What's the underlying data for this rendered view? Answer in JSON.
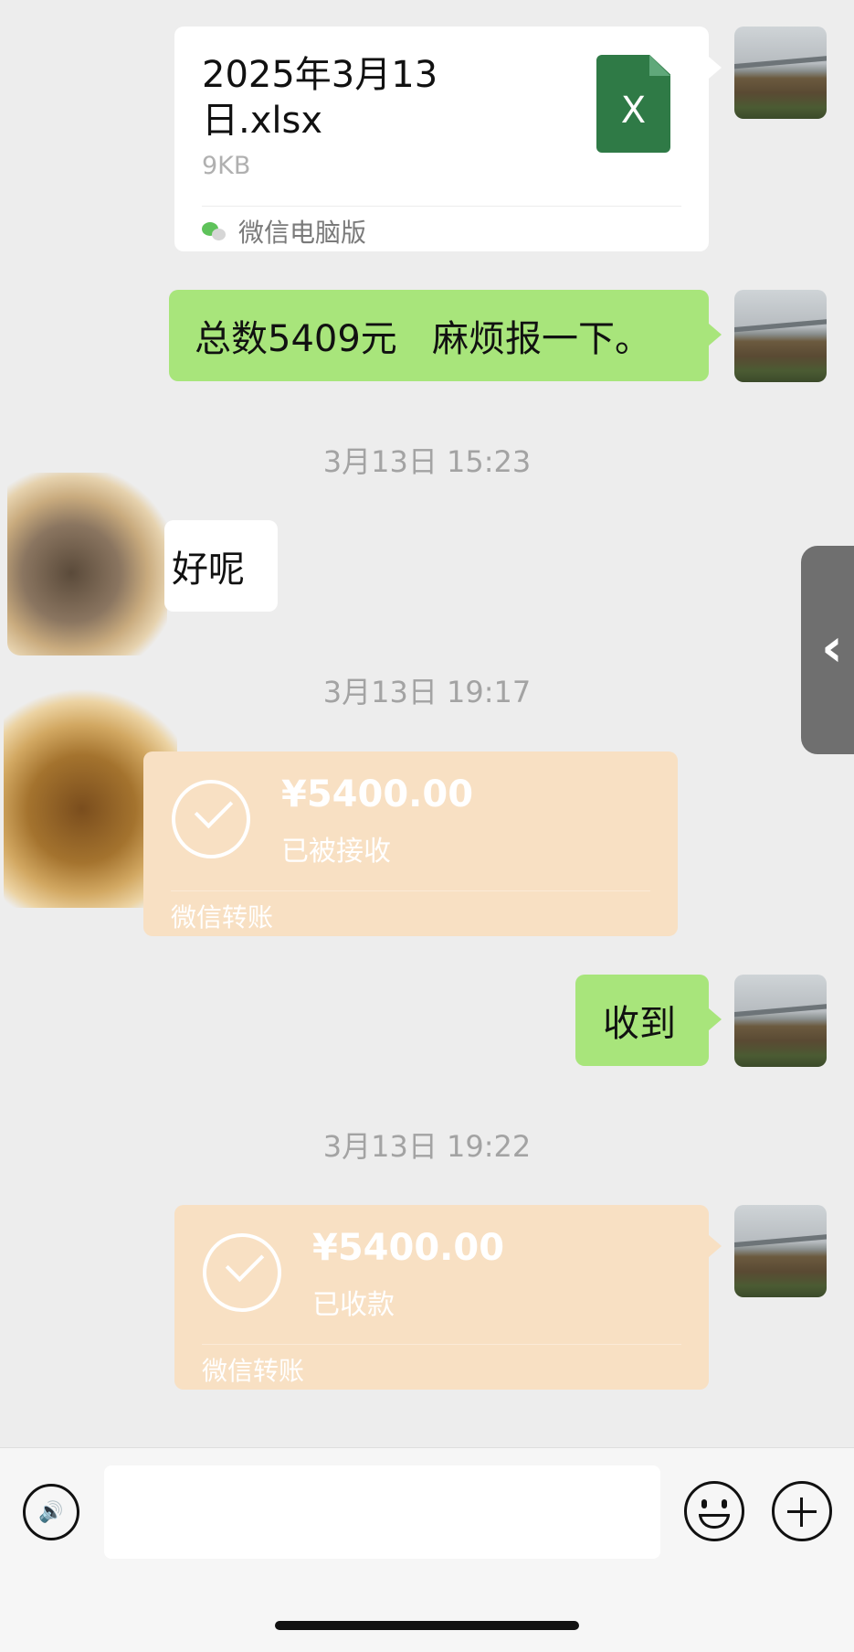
{
  "file_message": {
    "title": "2025年3月13日.xlsx",
    "size": "9KB",
    "source": "微信电脑版",
    "file_icon_letter": "X",
    "file_icon_color": "#2f7a46"
  },
  "messages": {
    "total_text": "总数5409元   麻烦报一下。",
    "reply_ok": "好呢",
    "received_text": "收到"
  },
  "timestamps": {
    "t1": "3月13日 15:23",
    "t2": "3月13日 19:17",
    "t3": "3月13日 19:22"
  },
  "transfers": {
    "incoming": {
      "amount": "¥5400.00",
      "status": "已被接收",
      "label": "微信转账"
    },
    "outgoing": {
      "amount": "¥5400.00",
      "status": "已收款",
      "label": "微信转账"
    }
  },
  "side_tab": {
    "glyph": "‹"
  },
  "input_bar": {
    "voice_glyph": "🔊"
  },
  "colors": {
    "green_bubble": "#a8e57b",
    "transfer_bg": "#f8e0c3",
    "chat_bg": "#ededed"
  },
  "icons": [
    "voice-icon",
    "emoji-icon",
    "plus-icon",
    "chevron-left-icon",
    "excel-file-icon",
    "wechat-icon",
    "check-circle-icon"
  ]
}
